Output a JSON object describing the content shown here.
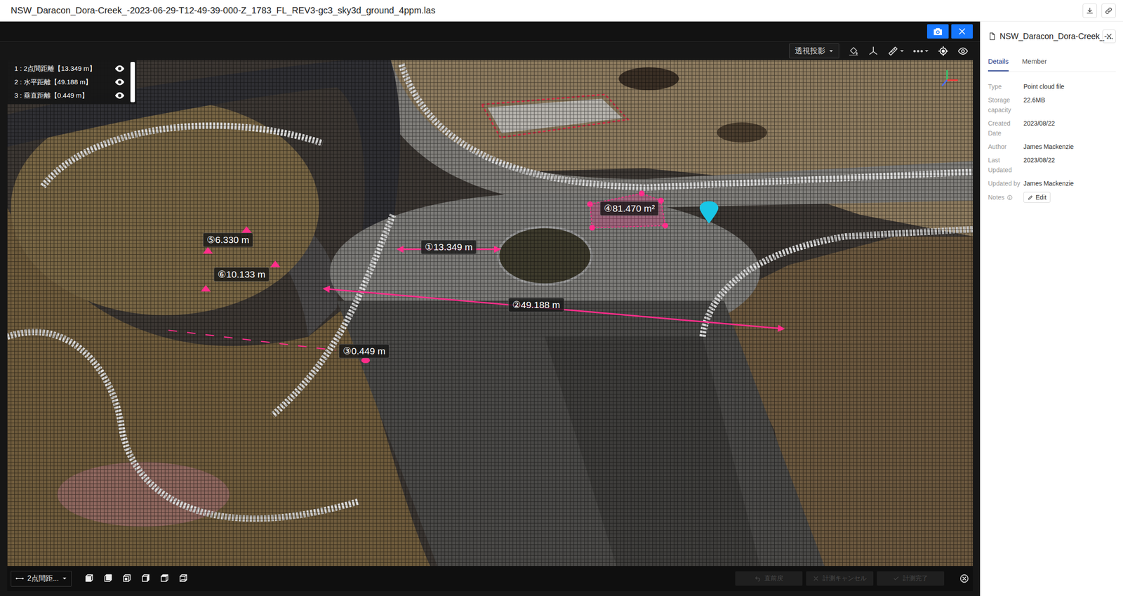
{
  "window": {
    "title": "NSW_Daracon_Dora-Creek_-2023-06-29-T12-49-39-000-Z_1783_FL_REV3-gc3_sky3d_ground_4ppm.las"
  },
  "viewer": {
    "projection": "透視投影",
    "layers": [
      {
        "label": "1 : 2点間距離【13.349 m】",
        "visible": true
      },
      {
        "label": "2 : 水平距離【49.188 m】",
        "visible": true
      },
      {
        "label": "3 : 垂直距離【0.449 m】",
        "visible": true
      }
    ],
    "annotations": [
      {
        "label": "①13.349 m",
        "kind": "distance"
      },
      {
        "label": "②49.188 m",
        "kind": "distance"
      },
      {
        "label": "③0.449 m",
        "kind": "vertical"
      },
      {
        "label": "④81.470 m²",
        "kind": "area"
      },
      {
        "label": "⑤6.330 m",
        "kind": "points"
      },
      {
        "label": "⑥10.133 m",
        "kind": "points"
      }
    ],
    "tool": "2点間距...",
    "actions": [
      {
        "label": "直前戻",
        "disabled": true
      },
      {
        "label": "計測キャンセル",
        "disabled": true
      },
      {
        "label": "計測完了",
        "disabled": true
      }
    ]
  },
  "panel": {
    "title": "NSW_Daracon_Dora-Creek_-...",
    "tabs": [
      {
        "label": "Details",
        "selected": true
      },
      {
        "label": "Member",
        "selected": false
      }
    ],
    "details": [
      {
        "label": "Type",
        "value": "Point cloud file"
      },
      {
        "label": "Storage capacity",
        "value": "22.6MB"
      },
      {
        "label": "Created Date",
        "value": "2023/08/22"
      },
      {
        "label": "Author",
        "value": "James Mackenzie"
      },
      {
        "label": "Last Updated",
        "value": "2023/08/22"
      },
      {
        "label": "Updated by",
        "value": "James Mackenzie"
      }
    ],
    "notes": {
      "label": "Notes",
      "action": "Edit"
    }
  }
}
